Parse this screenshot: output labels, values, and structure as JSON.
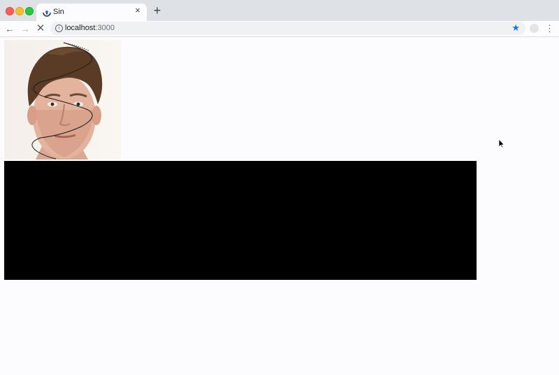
{
  "tab": {
    "title": "Sin",
    "icon": "react-icon",
    "close_label": "×"
  },
  "new_tab_label": "+",
  "toolbar": {
    "back_label": "←",
    "forward_label": "→",
    "stop_label": "✕",
    "info_label": "i"
  },
  "address": {
    "host": "localhost",
    "port": ":3000"
  },
  "bookmark_label": "★",
  "menu_label": "⋮",
  "colors": {
    "tab_strip": "#dee1e6",
    "page_background": "#fcfbfd",
    "bookmark_star": "#1a73e8",
    "content_block": "#000000"
  }
}
